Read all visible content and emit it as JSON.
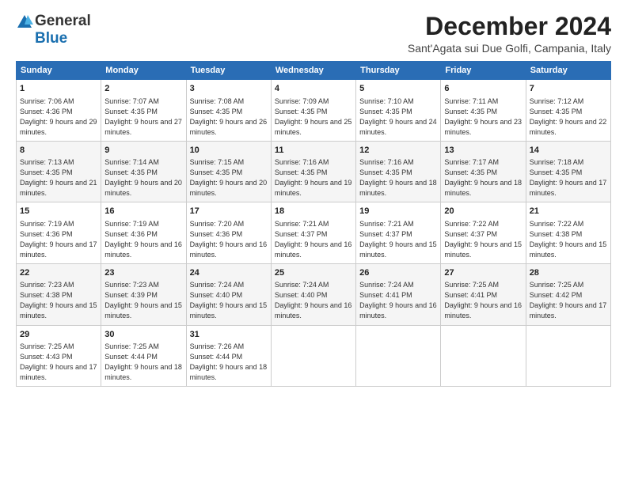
{
  "header": {
    "logo_general": "General",
    "logo_blue": "Blue",
    "title": "December 2024",
    "subtitle": "Sant'Agata sui Due Golfi, Campania, Italy"
  },
  "days_of_week": [
    "Sunday",
    "Monday",
    "Tuesday",
    "Wednesday",
    "Thursday",
    "Friday",
    "Saturday"
  ],
  "weeks": [
    [
      {
        "day": "1",
        "sunrise": "7:06 AM",
        "sunset": "4:36 PM",
        "daylight": "9 hours and 29 minutes."
      },
      {
        "day": "2",
        "sunrise": "7:07 AM",
        "sunset": "4:35 PM",
        "daylight": "9 hours and 27 minutes."
      },
      {
        "day": "3",
        "sunrise": "7:08 AM",
        "sunset": "4:35 PM",
        "daylight": "9 hours and 26 minutes."
      },
      {
        "day": "4",
        "sunrise": "7:09 AM",
        "sunset": "4:35 PM",
        "daylight": "9 hours and 25 minutes."
      },
      {
        "day": "5",
        "sunrise": "7:10 AM",
        "sunset": "4:35 PM",
        "daylight": "9 hours and 24 minutes."
      },
      {
        "day": "6",
        "sunrise": "7:11 AM",
        "sunset": "4:35 PM",
        "daylight": "9 hours and 23 minutes."
      },
      {
        "day": "7",
        "sunrise": "7:12 AM",
        "sunset": "4:35 PM",
        "daylight": "9 hours and 22 minutes."
      }
    ],
    [
      {
        "day": "8",
        "sunrise": "7:13 AM",
        "sunset": "4:35 PM",
        "daylight": "9 hours and 21 minutes."
      },
      {
        "day": "9",
        "sunrise": "7:14 AM",
        "sunset": "4:35 PM",
        "daylight": "9 hours and 20 minutes."
      },
      {
        "day": "10",
        "sunrise": "7:15 AM",
        "sunset": "4:35 PM",
        "daylight": "9 hours and 20 minutes."
      },
      {
        "day": "11",
        "sunrise": "7:16 AM",
        "sunset": "4:35 PM",
        "daylight": "9 hours and 19 minutes."
      },
      {
        "day": "12",
        "sunrise": "7:16 AM",
        "sunset": "4:35 PM",
        "daylight": "9 hours and 18 minutes."
      },
      {
        "day": "13",
        "sunrise": "7:17 AM",
        "sunset": "4:35 PM",
        "daylight": "9 hours and 18 minutes."
      },
      {
        "day": "14",
        "sunrise": "7:18 AM",
        "sunset": "4:35 PM",
        "daylight": "9 hours and 17 minutes."
      }
    ],
    [
      {
        "day": "15",
        "sunrise": "7:19 AM",
        "sunset": "4:36 PM",
        "daylight": "9 hours and 17 minutes."
      },
      {
        "day": "16",
        "sunrise": "7:19 AM",
        "sunset": "4:36 PM",
        "daylight": "9 hours and 16 minutes."
      },
      {
        "day": "17",
        "sunrise": "7:20 AM",
        "sunset": "4:36 PM",
        "daylight": "9 hours and 16 minutes."
      },
      {
        "day": "18",
        "sunrise": "7:21 AM",
        "sunset": "4:37 PM",
        "daylight": "9 hours and 16 minutes."
      },
      {
        "day": "19",
        "sunrise": "7:21 AM",
        "sunset": "4:37 PM",
        "daylight": "9 hours and 15 minutes."
      },
      {
        "day": "20",
        "sunrise": "7:22 AM",
        "sunset": "4:37 PM",
        "daylight": "9 hours and 15 minutes."
      },
      {
        "day": "21",
        "sunrise": "7:22 AM",
        "sunset": "4:38 PM",
        "daylight": "9 hours and 15 minutes."
      }
    ],
    [
      {
        "day": "22",
        "sunrise": "7:23 AM",
        "sunset": "4:38 PM",
        "daylight": "9 hours and 15 minutes."
      },
      {
        "day": "23",
        "sunrise": "7:23 AM",
        "sunset": "4:39 PM",
        "daylight": "9 hours and 15 minutes."
      },
      {
        "day": "24",
        "sunrise": "7:24 AM",
        "sunset": "4:40 PM",
        "daylight": "9 hours and 15 minutes."
      },
      {
        "day": "25",
        "sunrise": "7:24 AM",
        "sunset": "4:40 PM",
        "daylight": "9 hours and 16 minutes."
      },
      {
        "day": "26",
        "sunrise": "7:24 AM",
        "sunset": "4:41 PM",
        "daylight": "9 hours and 16 minutes."
      },
      {
        "day": "27",
        "sunrise": "7:25 AM",
        "sunset": "4:41 PM",
        "daylight": "9 hours and 16 minutes."
      },
      {
        "day": "28",
        "sunrise": "7:25 AM",
        "sunset": "4:42 PM",
        "daylight": "9 hours and 17 minutes."
      }
    ],
    [
      {
        "day": "29",
        "sunrise": "7:25 AM",
        "sunset": "4:43 PM",
        "daylight": "9 hours and 17 minutes."
      },
      {
        "day": "30",
        "sunrise": "7:25 AM",
        "sunset": "4:44 PM",
        "daylight": "9 hours and 18 minutes."
      },
      {
        "day": "31",
        "sunrise": "7:26 AM",
        "sunset": "4:44 PM",
        "daylight": "9 hours and 18 minutes."
      },
      null,
      null,
      null,
      null
    ]
  ]
}
